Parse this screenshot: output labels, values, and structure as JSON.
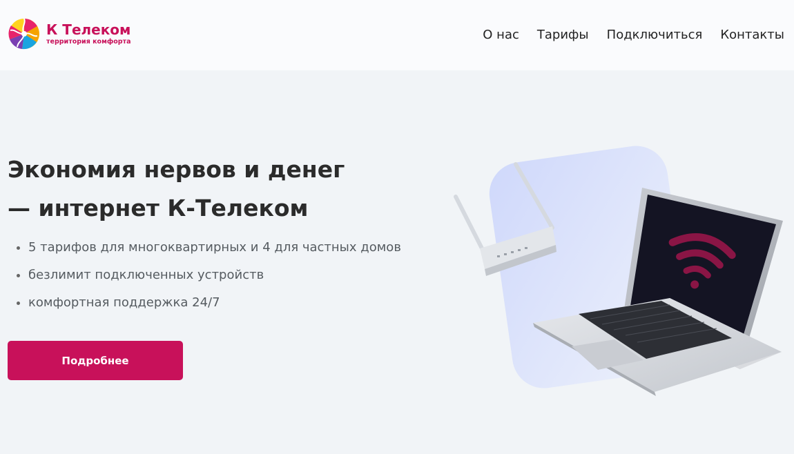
{
  "logo": {
    "title": "К Телеком",
    "subtitle": "территория комфорта"
  },
  "nav": {
    "items": [
      "О нас",
      "Тарифы",
      "Подключиться",
      "Контакты"
    ]
  },
  "hero": {
    "title_line1": "Экономия нервов и денег",
    "title_line2": "— интернет К-Телеком",
    "features": [
      "5 тарифов для многоквартирных и 4 для частных домов",
      "безлимит подключенных устройств",
      "комфортная поддержка 24/7"
    ],
    "button_label": "Подробнее"
  },
  "colors": {
    "brand": "#c8115a",
    "background": "#f1f4f7",
    "header_background": "#fafbfd"
  },
  "icons": [
    "k-telecom-logo-icon",
    "wifi-icon",
    "router-icon",
    "laptop-icon"
  ]
}
